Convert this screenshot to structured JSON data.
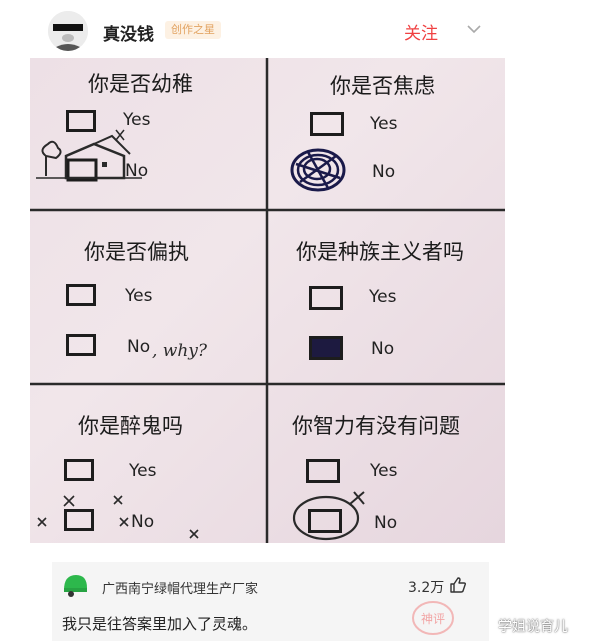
{
  "post": {
    "author": "真没钱",
    "badge": "创作之星",
    "follow_label": "关注"
  },
  "image": {
    "cells": [
      {
        "title": "你是否幼稚",
        "options": [
          "Yes",
          "No"
        ]
      },
      {
        "title": "你是否焦虑",
        "options": [
          "Yes",
          "No"
        ]
      },
      {
        "title": "你是否偏执",
        "options": [
          "Yes",
          "No"
        ],
        "handwriting": ", why?"
      },
      {
        "title": "你是种族主义者吗",
        "options": [
          "Yes",
          "No"
        ]
      },
      {
        "title": "你是醉鬼吗",
        "options": [
          "Yes",
          "No"
        ]
      },
      {
        "title": "你智力有没有问题",
        "options": [
          "Yes",
          "No"
        ]
      }
    ]
  },
  "comment": {
    "username": "广西南宁绿帽代理生产厂家",
    "likes": "3.2万",
    "text": "我只是往答案里加入了灵魂。",
    "stamp_text": "神评"
  },
  "watermark": "学姐说育儿",
  "colors": {
    "follow": "#f04142",
    "badge_text": "#e2a361",
    "avatar_green": "#2db84c"
  }
}
